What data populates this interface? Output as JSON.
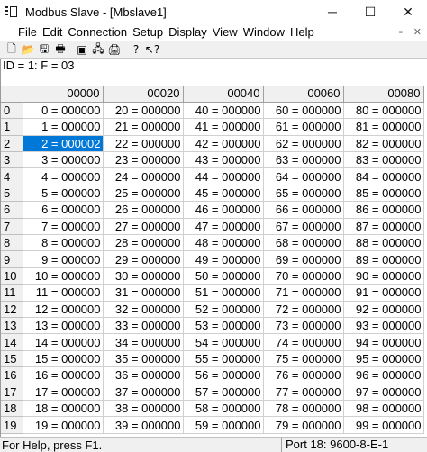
{
  "window": {
    "title": "Modbus Slave - [Mbslave1]",
    "controls": {
      "minimize": "─",
      "maximize": "☐",
      "close": "✕"
    }
  },
  "menu": [
    "File",
    "Edit",
    "Connection",
    "Setup",
    "Display",
    "View",
    "Window",
    "Help"
  ],
  "mdi_controls": [
    "─",
    "▫",
    "✕"
  ],
  "toolbar": [
    {
      "name": "new-document-icon",
      "glyph": "🗋"
    },
    {
      "name": "open-folder-icon",
      "glyph": "📂"
    },
    {
      "name": "save-icon",
      "glyph": "🖫"
    },
    {
      "name": "print-icon",
      "glyph": "🖶"
    },
    {
      "sep": true
    },
    {
      "name": "window-icon",
      "glyph": "▣"
    },
    {
      "name": "network-icon",
      "glyph": "🖧"
    },
    {
      "name": "printer-icon",
      "glyph": "🖨"
    },
    {
      "sep": true
    },
    {
      "name": "help-icon",
      "glyph": "?"
    },
    {
      "name": "context-help-icon",
      "glyph": "↖?"
    }
  ],
  "id_line": "ID = 1: F = 03",
  "grid": {
    "columns": [
      "00000",
      "00020",
      "00040",
      "00060",
      "00080"
    ],
    "rows": [
      "0",
      "1",
      "2",
      "3",
      "4",
      "5",
      "6",
      "7",
      "8",
      "9",
      "10",
      "11",
      "12",
      "13",
      "14",
      "15",
      "16",
      "17",
      "18",
      "19"
    ],
    "cells": [
      [
        "0 = 000000",
        "20 = 000000",
        "40 = 000000",
        "60 = 000000",
        "80 = 000000"
      ],
      [
        "1 = 000000",
        "21 = 000000",
        "41 = 000000",
        "61 = 000000",
        "81 = 000000"
      ],
      [
        "2 = 000002",
        "22 = 000000",
        "42 = 000000",
        "62 = 000000",
        "82 = 000000"
      ],
      [
        "3 = 000000",
        "23 = 000000",
        "43 = 000000",
        "63 = 000000",
        "83 = 000000"
      ],
      [
        "4 = 000000",
        "24 = 000000",
        "44 = 000000",
        "64 = 000000",
        "84 = 000000"
      ],
      [
        "5 = 000000",
        "25 = 000000",
        "45 = 000000",
        "65 = 000000",
        "85 = 000000"
      ],
      [
        "6 = 000000",
        "26 = 000000",
        "46 = 000000",
        "66 = 000000",
        "86 = 000000"
      ],
      [
        "7 = 000000",
        "27 = 000000",
        "47 = 000000",
        "67 = 000000",
        "87 = 000000"
      ],
      [
        "8 = 000000",
        "28 = 000000",
        "48 = 000000",
        "68 = 000000",
        "88 = 000000"
      ],
      [
        "9 = 000000",
        "29 = 000000",
        "49 = 000000",
        "69 = 000000",
        "89 = 000000"
      ],
      [
        "10 = 000000",
        "30 = 000000",
        "50 = 000000",
        "70 = 000000",
        "90 = 000000"
      ],
      [
        "11 = 000000",
        "31 = 000000",
        "51 = 000000",
        "71 = 000000",
        "91 = 000000"
      ],
      [
        "12 = 000000",
        "32 = 000000",
        "52 = 000000",
        "72 = 000000",
        "92 = 000000"
      ],
      [
        "13 = 000000",
        "33 = 000000",
        "53 = 000000",
        "73 = 000000",
        "93 = 000000"
      ],
      [
        "14 = 000000",
        "34 = 000000",
        "54 = 000000",
        "74 = 000000",
        "94 = 000000"
      ],
      [
        "15 = 000000",
        "35 = 000000",
        "55 = 000000",
        "75 = 000000",
        "95 = 000000"
      ],
      [
        "16 = 000000",
        "36 = 000000",
        "56 = 000000",
        "76 = 000000",
        "96 = 000000"
      ],
      [
        "17 = 000000",
        "37 = 000000",
        "57 = 000000",
        "77 = 000000",
        "97 = 000000"
      ],
      [
        "18 = 000000",
        "38 = 000000",
        "58 = 000000",
        "78 = 000000",
        "98 = 000000"
      ],
      [
        "19 = 000000",
        "39 = 000000",
        "59 = 000000",
        "79 = 000000",
        "99 = 000000"
      ]
    ],
    "selected": {
      "row": 2,
      "col": 0
    },
    "selection_color": "#0078d7"
  },
  "status": {
    "help": "For Help, press F1.",
    "port": "Port 18: 9600-8-E-1"
  }
}
